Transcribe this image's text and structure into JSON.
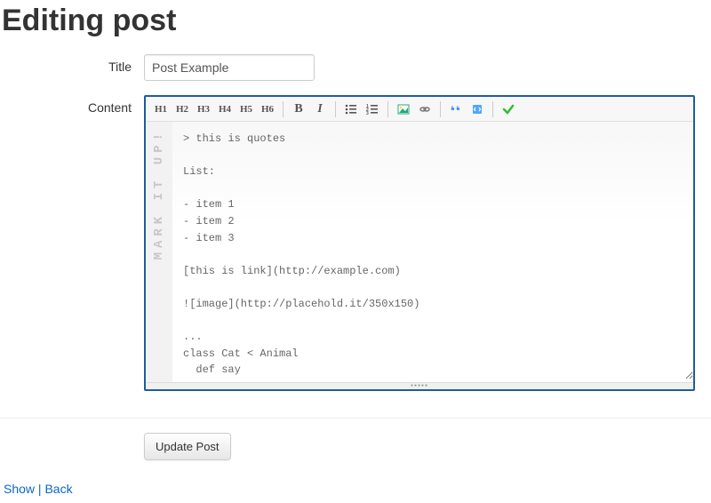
{
  "page": {
    "heading": "Editing post",
    "labels": {
      "title": "Title",
      "content": "Content"
    }
  },
  "form": {
    "title_value": "Post Example",
    "content_value": "> this is quotes\n\nList:\n\n- item 1\n- item 2\n- item 3\n\n[this is link](http://example.com)\n\n![image](http://placehold.it/350x150)\n\n...\nclass Cat < Animal\n  def say\n    \"Meow!\"\n  end\nend",
    "submit_label": "Update Post"
  },
  "toolbar": {
    "h1": "H1",
    "h2": "H2",
    "h3": "H3",
    "h4": "H4",
    "h5": "H5",
    "h6": "H6",
    "bold": "B",
    "italic": "I"
  },
  "editor": {
    "gutter_brand": "MARK IT UP!"
  },
  "links": {
    "show": "Show",
    "back": "Back",
    "separator": "|"
  }
}
